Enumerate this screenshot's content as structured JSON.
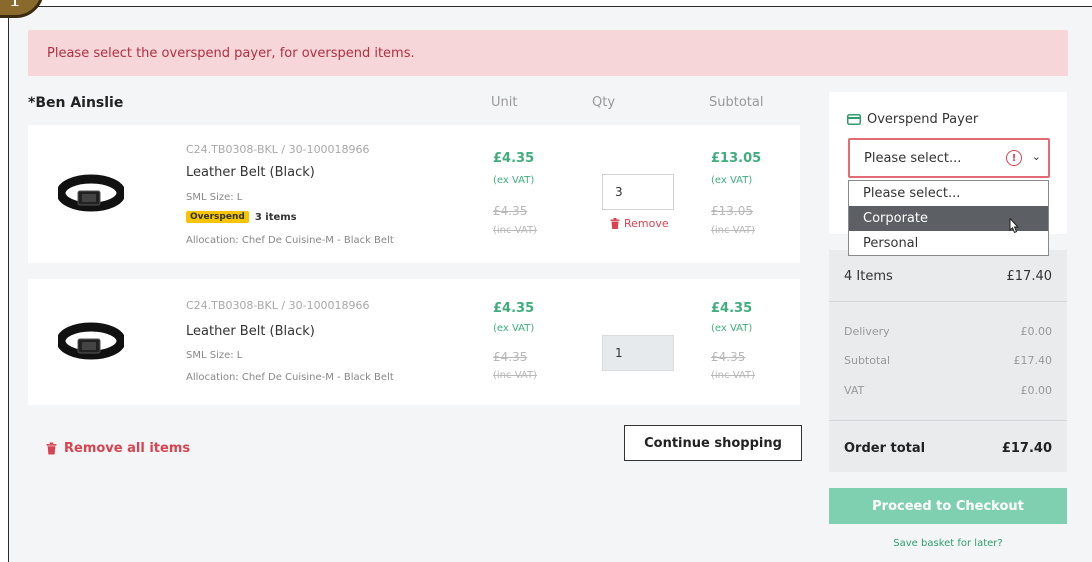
{
  "step": {
    "number": "1"
  },
  "alert": {
    "message": "Please select the overspend payer, for overspend items."
  },
  "recipient": {
    "name": "*Ben Ainslie"
  },
  "columns": {
    "unit": "Unit",
    "qty": "Qty",
    "subtotal": "Subtotal"
  },
  "items": [
    {
      "sku": "C24.TB0308-BKL / 30-100018966",
      "name": "Leather Belt (Black)",
      "size": "SML Size: L",
      "overspend_badge": "Overspend",
      "overspend_count": "3 items",
      "allocation": "Allocation: Chef De Cuisine-M - Black Belt",
      "unit_price": "£4.35",
      "unit_price_note": "(ex VAT)",
      "unit_price_inc": "£4.35",
      "unit_price_inc_note": "(inc VAT)",
      "qty": "3",
      "remove_label": "Remove",
      "subtotal": "£13.05",
      "subtotal_note": "(ex VAT)",
      "subtotal_inc": "£13.05",
      "subtotal_inc_note": "(inc VAT)"
    },
    {
      "sku": "C24.TB0308-BKL / 30-100018966",
      "name": "Leather Belt (Black)",
      "size": "SML Size: L",
      "allocation": "Allocation: Chef De Cuisine-M - Black Belt",
      "unit_price": "£4.35",
      "unit_price_note": "(ex VAT)",
      "unit_price_inc": "£4.35",
      "unit_price_inc_note": "(inc VAT)",
      "qty": "1",
      "subtotal": "£4.35",
      "subtotal_note": "(ex VAT)",
      "subtotal_inc": "£4.35",
      "subtotal_inc_note": "(inc VAT)"
    }
  ],
  "actions": {
    "remove_all": "Remove all items",
    "continue": "Continue shopping"
  },
  "overspend": {
    "label": "Overspend Payer",
    "selected": "Please select...",
    "options": [
      "Please select...",
      "Corporate",
      "Personal"
    ],
    "highlighted_option": "Corporate"
  },
  "summary": {
    "items_label": "4 Items",
    "items_value": "£17.40",
    "delivery_label": "Delivery",
    "delivery_value": "£0.00",
    "subtotal_label": "Subtotal",
    "subtotal_value": "£17.40",
    "vat_label": "VAT",
    "vat_value": "£0.00",
    "total_label": "Order total",
    "total_value": "£17.40"
  },
  "checkout": {
    "label": "Proceed to Checkout",
    "save_later": "Save basket for later?"
  },
  "colors": {
    "accent_green": "#3fae7c",
    "error_red": "#d8434f",
    "badge_yellow": "#f6c400",
    "checkout_green": "#7fd0b0"
  }
}
